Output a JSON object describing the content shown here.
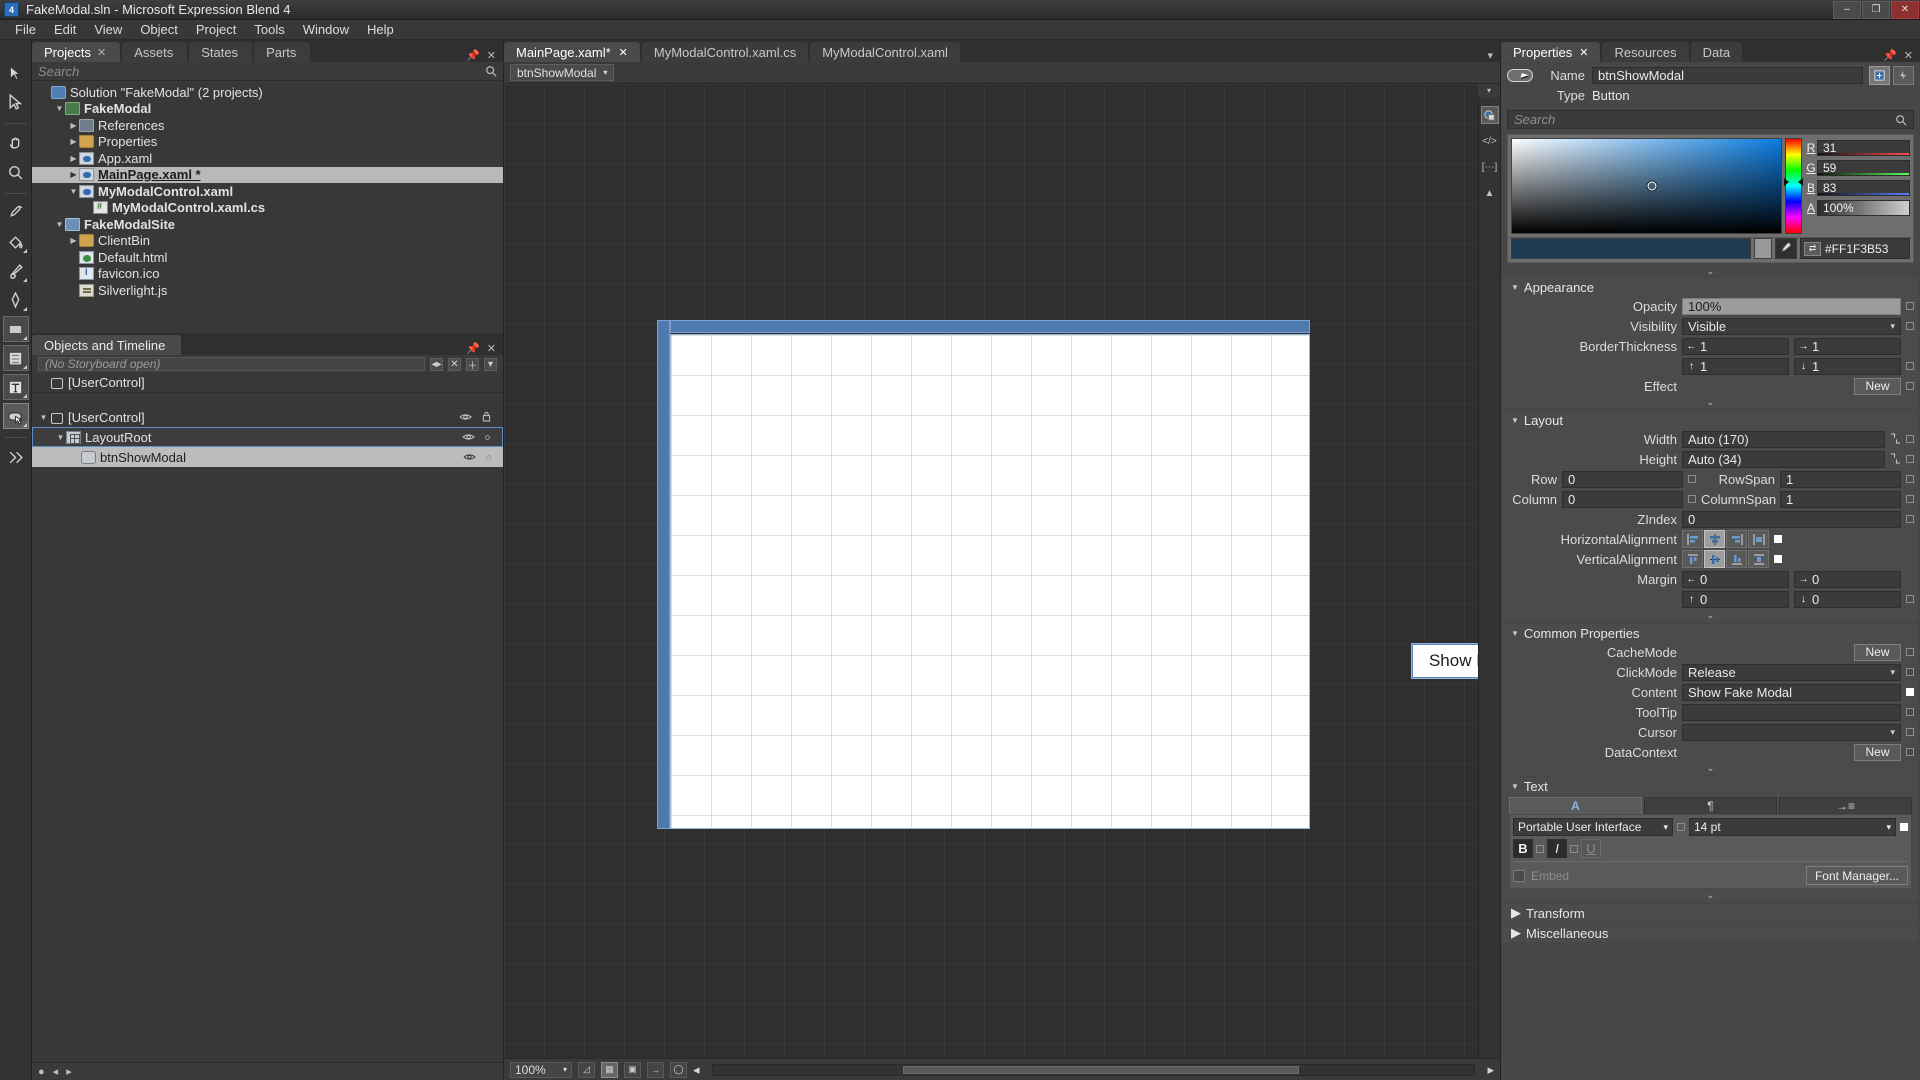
{
  "titlebar": {
    "icon_label": "4",
    "title": "FakeModal.sln - Microsoft Expression Blend 4",
    "minimize": "–",
    "maximize": "❐",
    "close": "✕"
  },
  "menubar": {
    "items": [
      "File",
      "Edit",
      "View",
      "Object",
      "Project",
      "Tools",
      "Window",
      "Help"
    ]
  },
  "toolstrip": {
    "tools": [
      {
        "name": "selection-tool"
      },
      {
        "name": "direct-selection-tool"
      },
      {
        "name": "pan-tool"
      },
      {
        "name": "zoom-tool"
      },
      {
        "name": "eyedropper-tool"
      },
      {
        "name": "paint-bucket-tool"
      },
      {
        "name": "brush-tool"
      },
      {
        "name": "pen-tool"
      },
      {
        "name": "rectangle-tool"
      },
      {
        "name": "layout-panel-tool"
      },
      {
        "name": "text-tool"
      },
      {
        "name": "button-control-tool"
      },
      {
        "name": "asset-library-tool"
      }
    ]
  },
  "projects_panel": {
    "tabs": [
      {
        "label": "Projects",
        "active": true,
        "closable": true
      },
      {
        "label": "Assets",
        "active": false,
        "closable": false
      },
      {
        "label": "States",
        "active": false,
        "closable": false
      },
      {
        "label": "Parts",
        "active": false,
        "closable": false
      }
    ],
    "search_placeholder": "Search",
    "tree": [
      {
        "label": "Solution \"FakeModal\" (2 projects)",
        "depth": 0,
        "twisty": "",
        "icon": "ic-sol",
        "selected": false,
        "underline": false
      },
      {
        "label": "FakeModal",
        "depth": 1,
        "twisty": "▼",
        "icon": "ic-csproj",
        "selected": false,
        "underline": false
      },
      {
        "label": "References",
        "depth": 2,
        "twisty": "▶",
        "icon": "ic-ref",
        "selected": false,
        "underline": false
      },
      {
        "label": "Properties",
        "depth": 2,
        "twisty": "▶",
        "icon": "ic-folder",
        "selected": false,
        "underline": false
      },
      {
        "label": "App.xaml",
        "depth": 2,
        "twisty": "▶",
        "icon": "ic-xaml",
        "selected": false,
        "underline": false
      },
      {
        "label": "MainPage.xaml *",
        "depth": 2,
        "twisty": "▶",
        "icon": "ic-xaml",
        "selected": true,
        "underline": true
      },
      {
        "label": "MyModalControl.xaml",
        "depth": 2,
        "twisty": "▼",
        "icon": "ic-xaml",
        "selected": false,
        "underline": false
      },
      {
        "label": "MyModalControl.xaml.cs",
        "depth": 3,
        "twisty": "",
        "icon": "ic-cs",
        "selected": false,
        "underline": false
      },
      {
        "label": "FakeModalSite",
        "depth": 1,
        "twisty": "▼",
        "icon": "ic-web",
        "selected": false,
        "underline": false
      },
      {
        "label": "ClientBin",
        "depth": 2,
        "twisty": "▶",
        "icon": "ic-folder",
        "selected": false,
        "underline": false
      },
      {
        "label": "Default.html",
        "depth": 2,
        "twisty": "",
        "icon": "ic-html",
        "selected": false,
        "underline": false
      },
      {
        "label": "favicon.ico",
        "depth": 2,
        "twisty": "",
        "icon": "ic-ico",
        "selected": false,
        "underline": false
      },
      {
        "label": "Silverlight.js",
        "depth": 2,
        "twisty": "",
        "icon": "ic-js",
        "selected": false,
        "underline": false
      }
    ]
  },
  "objects_panel": {
    "title": "Objects and Timeline",
    "storyboard_text": "(No Storyboard open)",
    "storyboard_buttons": [
      "◂▸",
      "✕",
      "＋",
      "▾"
    ],
    "items": [
      {
        "label": "[UserControl]",
        "depth": 0,
        "twisty": "",
        "icon": "ic-uc",
        "state": "breadcrumb"
      },
      {
        "label": "[UserControl]",
        "depth": 0,
        "twisty": "▼",
        "icon": "ic-uc",
        "state": "normal"
      },
      {
        "label": "LayoutRoot",
        "depth": 1,
        "twisty": "▼",
        "icon": "ic-grid",
        "state": "outlined"
      },
      {
        "label": "btnShowModal",
        "depth": 2,
        "twisty": "",
        "icon": "ic-btn",
        "state": "selected"
      }
    ]
  },
  "document_tabs": [
    {
      "label": "MainPage.xaml*",
      "active": true,
      "closable": true
    },
    {
      "label": "MyModalControl.xaml.cs",
      "active": false,
      "closable": false
    },
    {
      "label": "MyModalControl.xaml",
      "active": false,
      "closable": false
    }
  ],
  "breadcrumb": {
    "label": "btnShowModal",
    "chevron": "▾"
  },
  "artboard": {
    "button_content": "Show Fake Modal"
  },
  "statusbar": {
    "zoom": "100%",
    "chevron": "▾",
    "buttons": [
      "snap-to-gridlines",
      "show-grid",
      "snap-to-snaplines",
      "show-snap-grid",
      "annotations"
    ],
    "scroll_arrow_left": "◂",
    "scroll_arrow_right": "▸"
  },
  "properties_panel": {
    "tabs": [
      {
        "label": "Properties",
        "active": true,
        "closable": true
      },
      {
        "label": "Resources",
        "active": false,
        "closable": false
      },
      {
        "label": "Data",
        "active": false,
        "closable": false
      }
    ],
    "name_label": "Name",
    "name_value": "btnShowModal",
    "type_label": "Type",
    "type_value": "Button",
    "search_placeholder": "Search",
    "color": {
      "r_label": "R",
      "r": "31",
      "g_label": "G",
      "g": "59",
      "b_label": "B",
      "b": "83",
      "a_label": "A",
      "a": "100%",
      "hex": "#FF1F3B53",
      "swatch_hex": "#1F3B53"
    },
    "appearance": {
      "title": "Appearance",
      "opacity_label": "Opacity",
      "opacity": "100%",
      "visibility_label": "Visibility",
      "visibility": "Visible",
      "border_label": "BorderThickness",
      "border_left": "1",
      "border_right": "1",
      "border_top": "1",
      "border_bottom": "1",
      "effect_label": "Effect",
      "effect_button": "New"
    },
    "layout": {
      "title": "Layout",
      "width_label": "Width",
      "width": "Auto (170)",
      "height_label": "Height",
      "height": "Auto (34)",
      "row_label": "Row",
      "row": "0",
      "rowspan_label": "RowSpan",
      "rowspan": "1",
      "column_label": "Column",
      "column": "0",
      "columnspan_label": "ColumnSpan",
      "columnspan": "1",
      "zindex_label": "ZIndex",
      "zindex": "0",
      "halign_label": "HorizontalAlignment",
      "halign_selected": 1,
      "valign_label": "VerticalAlignment",
      "valign_selected": 1,
      "margin_label": "Margin",
      "margin_left": "0",
      "margin_right": "0",
      "margin_top": "0",
      "margin_bottom": "0"
    },
    "common": {
      "title": "Common Properties",
      "cachemode_label": "CacheMode",
      "cachemode_button": "New",
      "clickmode_label": "ClickMode",
      "clickmode": "Release",
      "content_label": "Content",
      "content": "Show Fake Modal",
      "tooltip_label": "ToolTip",
      "tooltip": "",
      "cursor_label": "Cursor",
      "cursor": "",
      "datacontext_label": "DataContext",
      "datacontext_button": "New"
    },
    "text": {
      "title": "Text",
      "tabs": [
        "character-panel",
        "paragraph-panel",
        "layout-panel"
      ],
      "font": "Portable User Interface",
      "size": "14 pt",
      "bold": "B",
      "italic": "I",
      "underline": "U",
      "embed_label": "Embed",
      "font_manager_button": "Font Manager..."
    },
    "transform_title": "Transform",
    "misc_title": "Miscellaneous"
  }
}
